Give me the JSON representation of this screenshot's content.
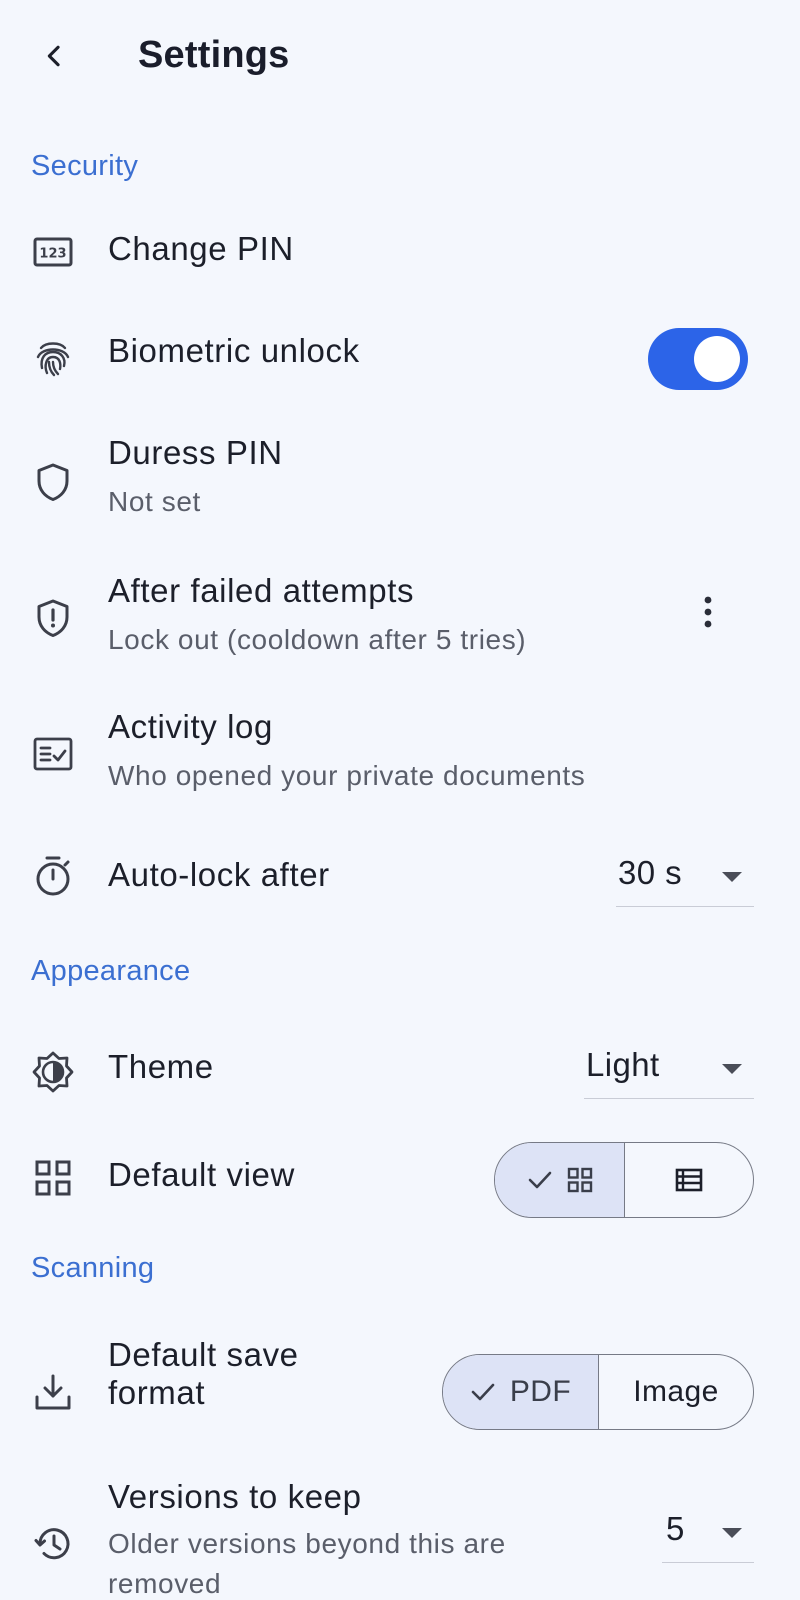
{
  "header": {
    "title": "Settings",
    "back_icon": "chevron-left-icon"
  },
  "colors": {
    "accent": "#2c64e8",
    "section_header": "#3b6fd1",
    "background": "#f4f7fd",
    "segment_selected": "#dde3f6"
  },
  "sections": {
    "security": {
      "title": "Security",
      "change_pin": {
        "label": "Change PIN",
        "icon": "pin-123-icon"
      },
      "biometric": {
        "label": "Biometric unlock",
        "icon": "fingerprint-icon",
        "enabled": true
      },
      "duress": {
        "label": "Duress PIN",
        "sublabel": "Not set",
        "icon": "shield-icon"
      },
      "failed_attempts": {
        "label": "After failed attempts",
        "sublabel": "Lock out (cooldown after 5 tries)",
        "icon": "shield-alert-icon"
      },
      "activity_log": {
        "label": "Activity log",
        "sublabel": "Who opened your private documents",
        "icon": "fact-check-icon"
      },
      "auto_lock": {
        "label": "Auto-lock after",
        "value": "30 s",
        "icon": "timer-icon"
      }
    },
    "appearance": {
      "title": "Appearance",
      "theme": {
        "label": "Theme",
        "value": "Light",
        "icon": "brightness-icon"
      },
      "default_view": {
        "label": "Default view",
        "icon": "grid-view-icon",
        "options": [
          "grid",
          "list"
        ],
        "selected": "grid"
      }
    },
    "scanning": {
      "title": "Scanning",
      "save_format": {
        "label_line1": "Default save",
        "label_line2": "format",
        "icon": "download-icon",
        "options": [
          "PDF",
          "Image"
        ],
        "selected": "PDF"
      },
      "versions": {
        "label": "Versions to keep",
        "sublabel_line1": "Older versions beyond this are",
        "sublabel_line2": "removed",
        "value": "5",
        "icon": "history-icon"
      }
    }
  }
}
